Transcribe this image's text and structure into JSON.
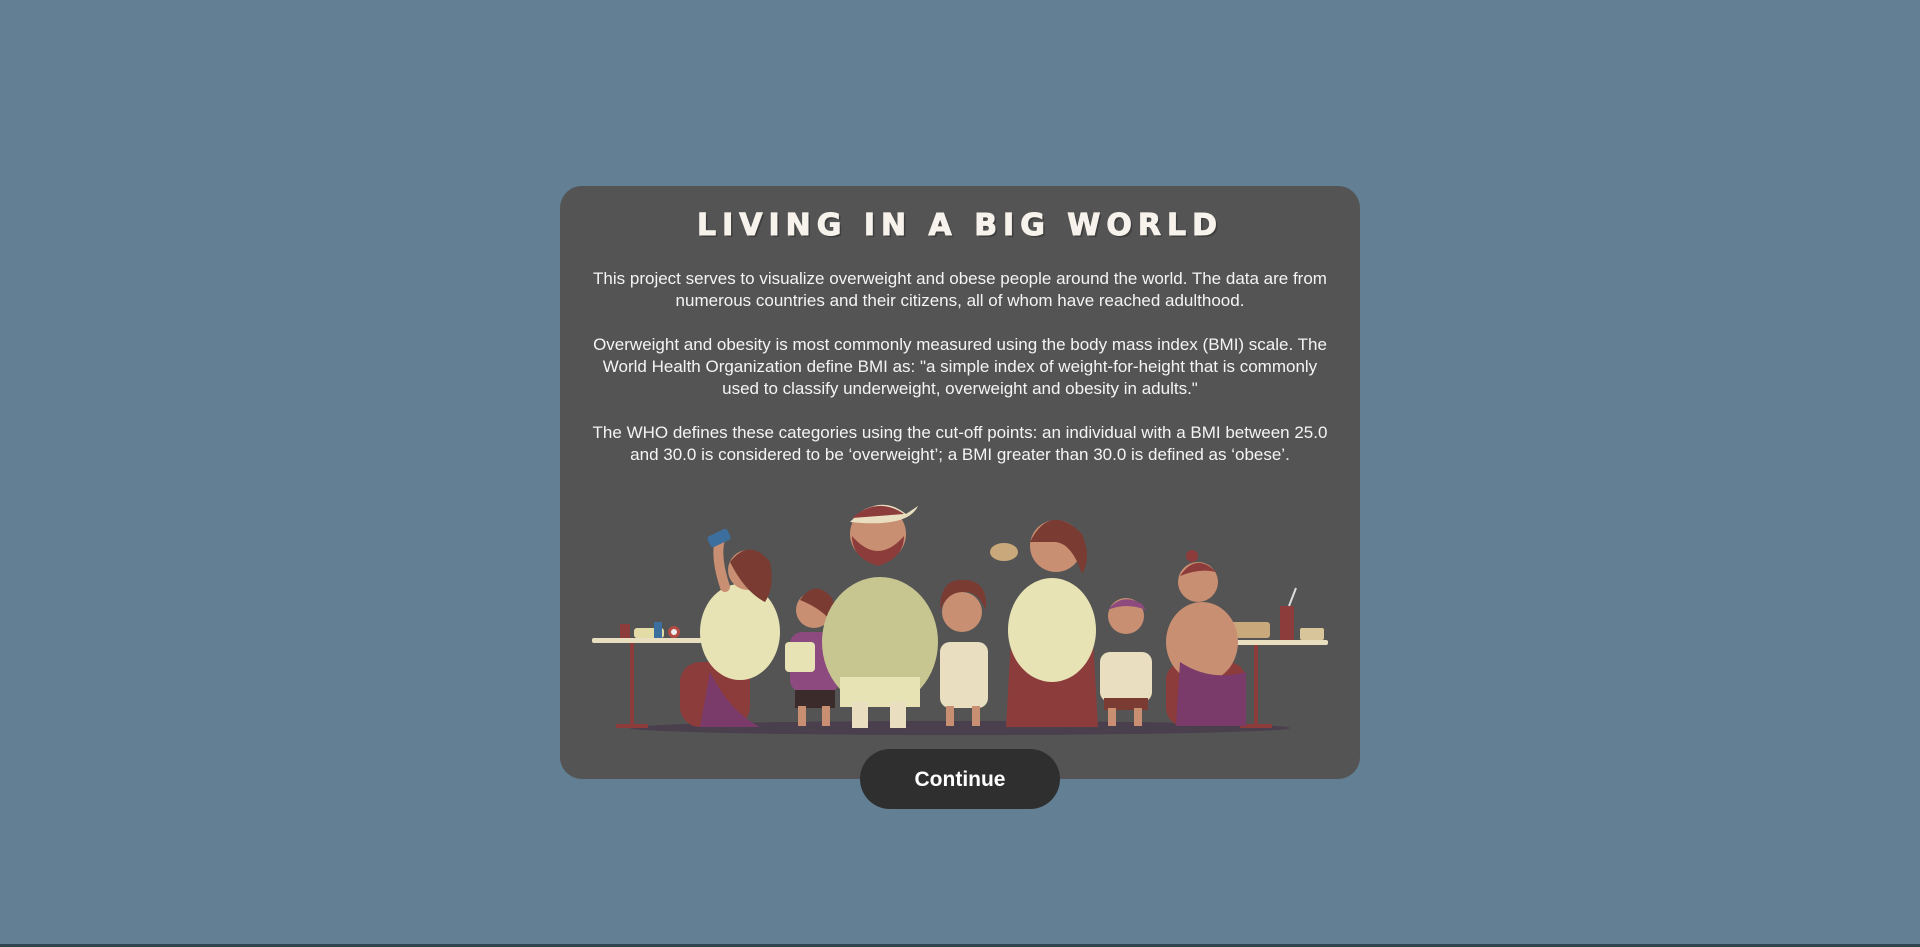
{
  "modal": {
    "title": "LIVING IN A BIG WORLD",
    "paragraphs": [
      "This project serves to visualize overweight and obese people around the world. The data are from numerous countries and their citizens, all of whom have reached adulthood.",
      "Overweight and obesity is most commonly measured using the body mass index (BMI) scale. The World Health Organization define BMI as: \"a simple index of weight-for-height that is commonly used to classify underweight, overweight and obesity in adults.\"",
      "The WHO defines these categories using the cut-off points: an individual with a BMI between 25.0 and 30.0 is considered to be ‘overweight’; a BMI greater than 30.0 is defined as ‘obese’."
    ],
    "illustration_icon": "people-eating-fast-food-illustration"
  },
  "continue_button": {
    "label": "Continue"
  },
  "colors": {
    "background": "#637f93",
    "modal": "#545454",
    "button": "#2f2f2f"
  }
}
